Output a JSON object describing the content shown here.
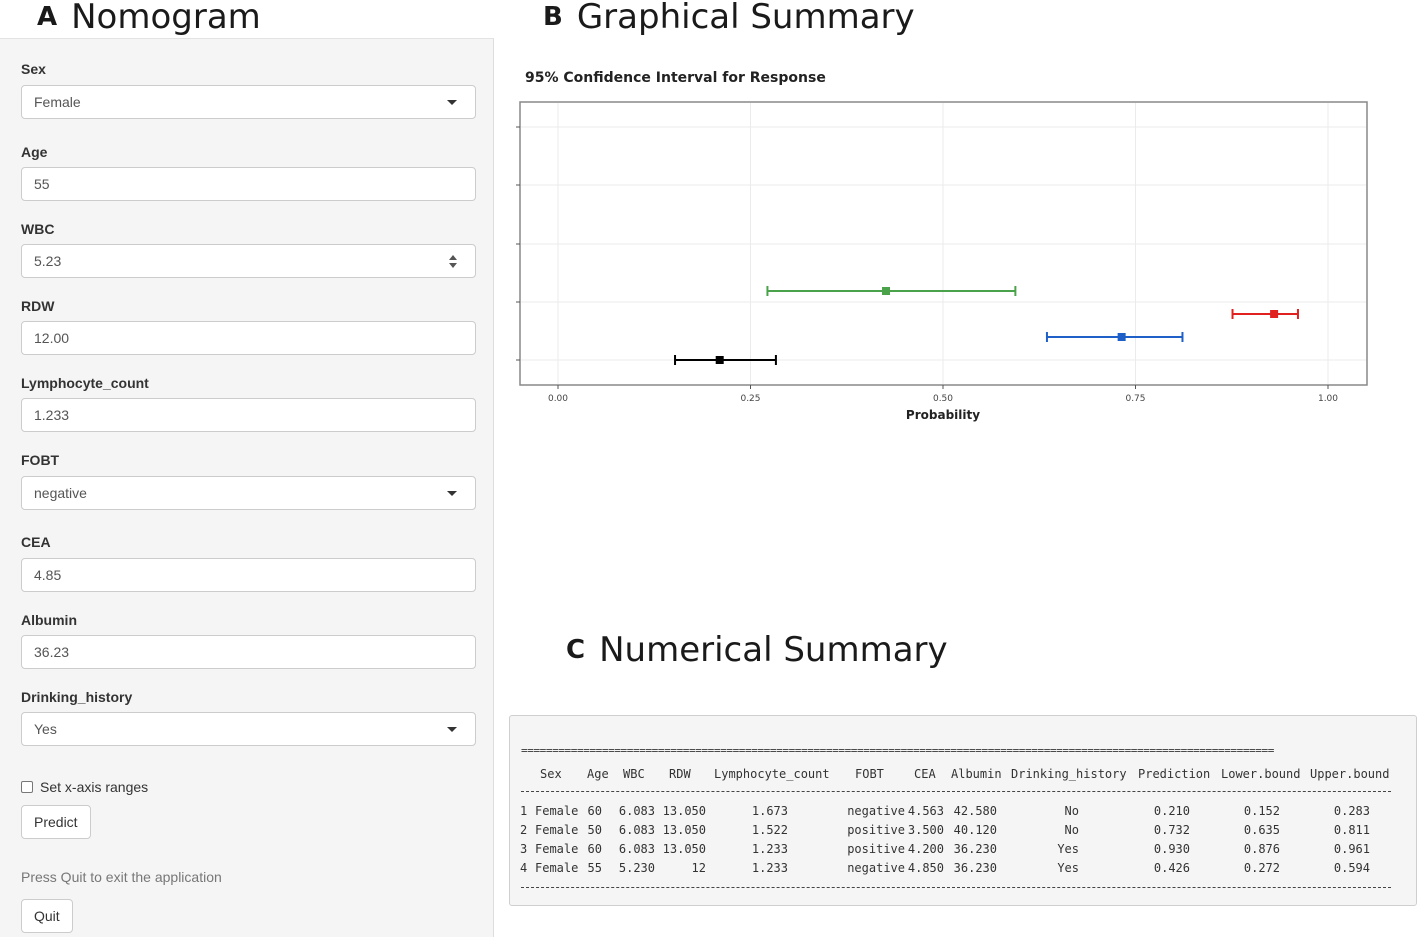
{
  "panel_a": {
    "letter": "A",
    "title": "Nomogram"
  },
  "panel_b": {
    "letter": "B",
    "title": "Graphical Summary"
  },
  "panel_c": {
    "letter": "C",
    "title": "Numerical Summary"
  },
  "sidebar": {
    "fields": [
      {
        "label": "Sex",
        "value": "Female",
        "kind": "select"
      },
      {
        "label": "Age",
        "value": "55",
        "kind": "text"
      },
      {
        "label": "WBC",
        "value": "5.23",
        "kind": "number"
      },
      {
        "label": "RDW",
        "value": "12.00",
        "kind": "text"
      },
      {
        "label": "Lymphocyte_count",
        "value": "1.233",
        "kind": "text"
      },
      {
        "label": "FOBT",
        "value": "negative",
        "kind": "select"
      },
      {
        "label": "CEA",
        "value": "4.85",
        "kind": "text"
      },
      {
        "label": "Albumin",
        "value": "36.23",
        "kind": "text"
      },
      {
        "label": "Drinking_history",
        "value": "Yes",
        "kind": "select"
      }
    ],
    "checkbox_label": "Set x-axis ranges",
    "checkbox_checked": false,
    "predict_label": "Predict",
    "help_text": "Press Quit to exit the application",
    "quit_label": "Quit"
  },
  "chart_data": {
    "type": "scatter",
    "title": "95% Confidence Interval for Response",
    "xlabel": "Probability",
    "ylabel": "",
    "xlim": [
      0,
      1
    ],
    "x_ticks": [
      "0.00",
      "0.25",
      "0.50",
      "0.75",
      "1.00"
    ],
    "grid": true,
    "series": [
      {
        "point": 0.21,
        "lower": 0.152,
        "upper": 0.283,
        "color": "#000000"
      },
      {
        "point": 0.732,
        "lower": 0.635,
        "upper": 0.811,
        "color": "#1f5fc8"
      },
      {
        "point": 0.93,
        "lower": 0.876,
        "upper": 0.961,
        "color": "#e0211f"
      },
      {
        "point": 0.426,
        "lower": 0.272,
        "upper": 0.594,
        "color": "#4aa34a"
      }
    ]
  },
  "table": {
    "separator": "=========================================================================================================================",
    "headers": [
      "Sex",
      "Age",
      "WBC",
      "RDW",
      "Lymphocyte_count",
      "FOBT",
      "CEA",
      "Albumin",
      "Drinking_history",
      "Prediction",
      "Lower.bound",
      "Upper.bound"
    ],
    "rows": [
      [
        "1",
        "Female",
        "60",
        "6.083",
        "13.050",
        "1.673",
        "negative",
        "4.563",
        "42.580",
        "No",
        "0.210",
        "0.152",
        "0.283"
      ],
      [
        "2",
        "Female",
        "50",
        "6.083",
        "13.050",
        "1.522",
        "positive",
        "3.500",
        "40.120",
        "No",
        "0.732",
        "0.635",
        "0.811"
      ],
      [
        "3",
        "Female",
        "60",
        "6.083",
        "13.050",
        "1.233",
        "positive",
        "4.200",
        "36.230",
        "Yes",
        "0.930",
        "0.876",
        "0.961"
      ],
      [
        "4",
        "Female",
        "55",
        "5.230",
        "12",
        "1.233",
        "negative",
        "4.850",
        "36.230",
        "Yes",
        "0.426",
        "0.272",
        "0.594"
      ]
    ]
  }
}
